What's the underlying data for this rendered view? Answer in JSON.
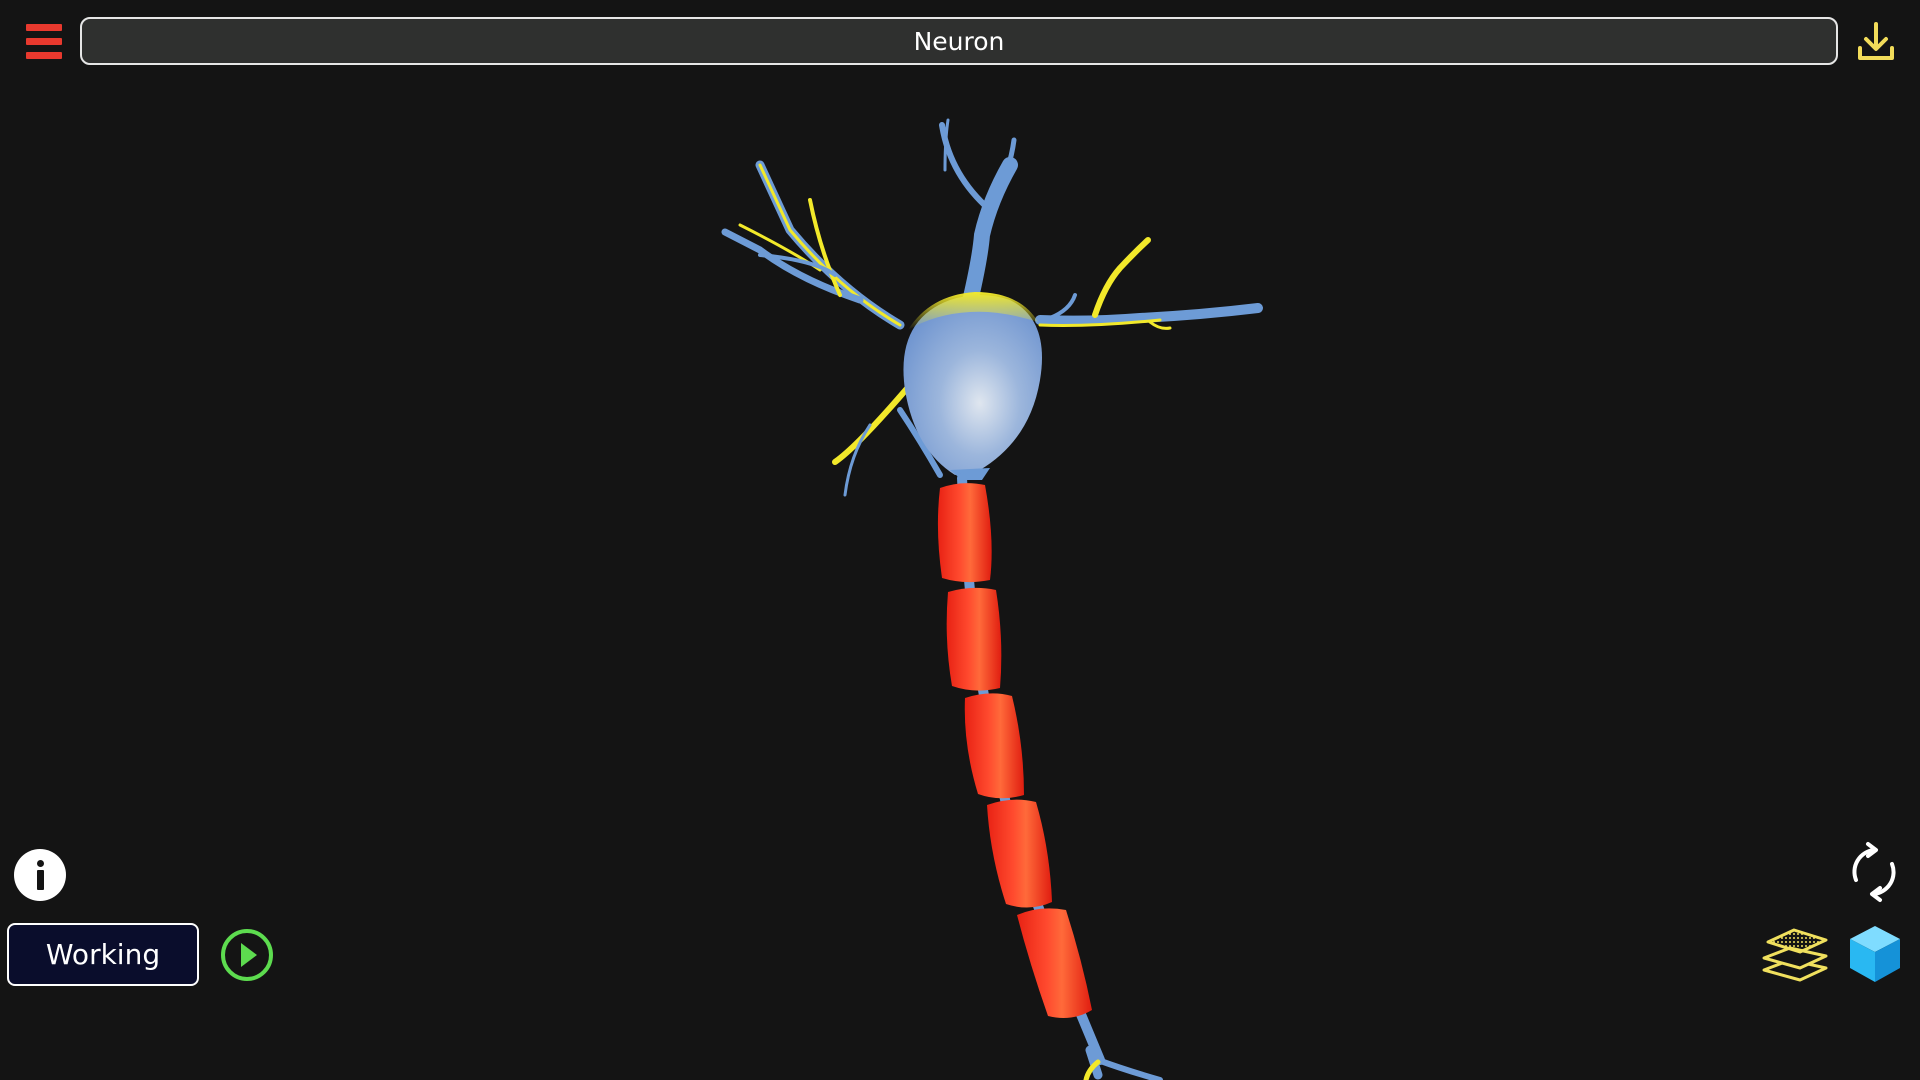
{
  "header": {
    "title": "Neuron",
    "menu_icon": "hamburger-menu-icon",
    "download_icon": "download-icon"
  },
  "controls": {
    "info_icon": "info-icon",
    "mode_label": "Working",
    "play_icon": "play-icon",
    "rotate_icon": "rotate-icon",
    "layers_icon": "layers-icon",
    "cube_icon": "cube-icon"
  },
  "colors": {
    "background": "#141414",
    "accent_red": "#e8392e",
    "title_bar_bg": "#2f302f",
    "mode_button_bg": "#0a0d2c",
    "play_green": "#5ddc4f",
    "download_yellow": "#f2dc5a",
    "layers_yellow": "#f0e05e",
    "cube_blue": "#29b8f2",
    "neuron_blue": "#6d9bd6",
    "neuron_yellow": "#f2e92a",
    "myelin_red": "#f22a1a"
  }
}
